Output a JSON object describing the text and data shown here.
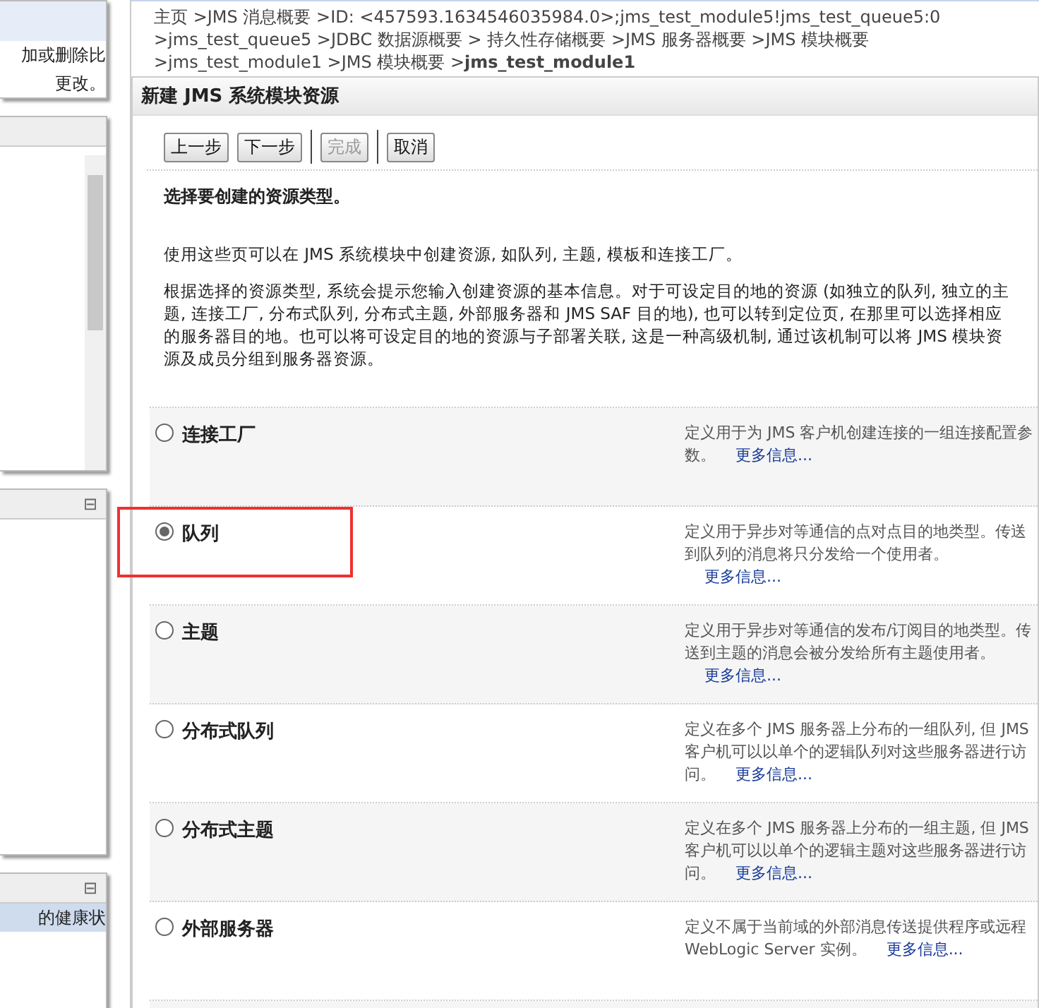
{
  "sidebar": {
    "panels": [
      {
        "kind": "text",
        "lines": [
          "加或删除比",
          "更改。"
        ]
      },
      {
        "kind": "scroll"
      },
      {
        "kind": "collapsible",
        "toggle": "⊟"
      },
      {
        "kind": "collapsible",
        "toggle": "⊟",
        "lines": [
          "的健康状"
        ]
      }
    ]
  },
  "breadcrumb": "主页 >JMS 消息概要 >ID: <457593.1634546035984.0>;jms_test_module5!jms_test_queue5:0 >jms_test_queue5 >JDBC 数据源概要 > 持久性存储概要 >JMS 服务器概要 >JMS 模块概要 >jms_test_module1 >JMS 模块概要 >**jms_test_module1**",
  "panel": {
    "title": "新建 JMS 系统模块资源",
    "buttons": [
      {
        "label": "上一步",
        "disabled": false
      },
      {
        "label": "下一步",
        "disabled": false
      },
      {
        "label": "完成",
        "disabled": true
      },
      {
        "label": "取消",
        "disabled": false
      }
    ],
    "heading": "选择要创建的资源类型。",
    "paragraphs": [
      "使用这些页可以在 JMS 系统模块中创建资源, 如队列, 主题, 模板和连接工厂。",
      "根据选择的资源类型, 系统会提示您输入创建资源的基本信息。对于可设定目的地的资源 (如独立的队列, 独立的主题, 连接工厂, 分布式队列, 分布式主题, 外部服务器和 JMS SAF 目的地), 也可以转到定位页, 在那里可以选择相应的服务器目的地。也可以将可设定目的地的资源与子部署关联, 这是一种高级机制, 通过该机制可以将 JMS 模块资源及成员分组到服务器资源。"
    ],
    "options": [
      {
        "label": "连接工厂",
        "selected": false,
        "description": "定义用于为 JMS 客户机创建连接的一组连接配置参数。",
        "link": "更多信息..."
      },
      {
        "label": "队列",
        "selected": true,
        "highlighted": true,
        "description": "定义用于异步对等通信的点对点目的地类型。传送到队列的消息将只分发给一个使用者。",
        "link": "更多信息..."
      },
      {
        "label": "主题",
        "selected": false,
        "description": "定义用于异步对等通信的发布/订阅目的地类型。传送到主题的消息会被分发给所有主题使用者。",
        "link": "更多信息..."
      },
      {
        "label": "分布式队列",
        "selected": false,
        "description": "定义在多个 JMS 服务器上分布的一组队列, 但 JMS 客户机可以以单个的逻辑队列对这些服务器进行访问。",
        "link": "更多信息..."
      },
      {
        "label": "分布式主题",
        "selected": false,
        "description": "定义在多个 JMS 服务器上分布的一组主题, 但 JMS 客户机可以以单个的逻辑主题对这些服务器进行访问。",
        "link": "更多信息..."
      },
      {
        "label": "外部服务器",
        "selected": false,
        "description": "定义不属于当前域的外部消息传送提供程序或远程 WebLogic Server 实例。",
        "link": "更多信息..."
      }
    ]
  }
}
